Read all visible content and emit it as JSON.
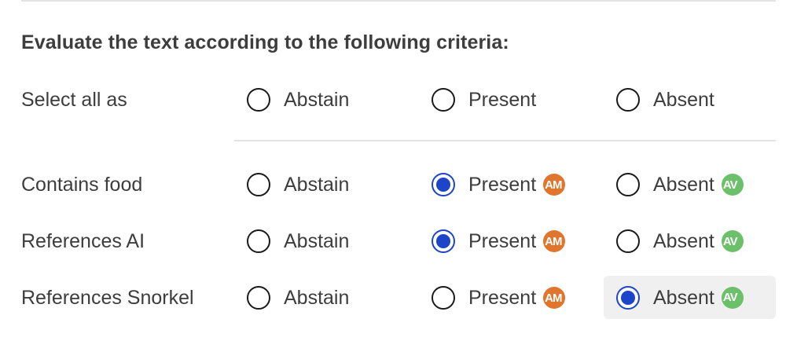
{
  "heading": "Evaluate the text according to the following criteria:",
  "select_all": {
    "label": "Select all as",
    "options": [
      "Abstain",
      "Present",
      "Absent"
    ]
  },
  "criteria": [
    {
      "label": "Contains food",
      "options": [
        "Abstain",
        "Present",
        "Absent"
      ],
      "selected": "Present",
      "present_badge": "AM",
      "absent_badge": "AV"
    },
    {
      "label": "References AI",
      "options": [
        "Abstain",
        "Present",
        "Absent"
      ],
      "selected": "Present",
      "present_badge": "AM",
      "absent_badge": "AV"
    },
    {
      "label": "References Snorkel",
      "options": [
        "Abstain",
        "Present",
        "Absent"
      ],
      "selected": "Absent",
      "present_badge": "AM",
      "absent_badge": "AV"
    }
  ],
  "colors": {
    "radio_selected": "#1d45c9",
    "badge_am": "#e0762d",
    "badge_av": "#6cc06a",
    "hover_bg": "#f0f0f0",
    "divider": "#e3e3e3"
  }
}
